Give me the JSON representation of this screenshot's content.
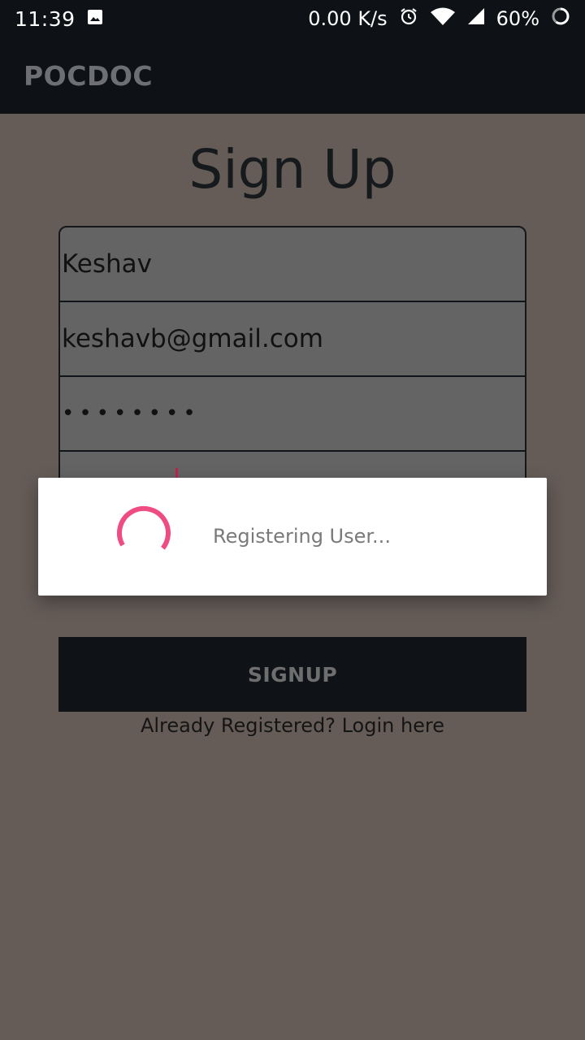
{
  "status_bar": {
    "time": "11:39",
    "network_speed": "0.00 K/s",
    "battery_percent": "60%",
    "icons": [
      "gallery-icon",
      "alarm-icon",
      "wifi-icon",
      "cellular-signal-icon",
      "battery-icon"
    ]
  },
  "app_bar": {
    "title": "POCDOC"
  },
  "page": {
    "title": "Sign Up"
  },
  "form": {
    "name_value": "Keshav",
    "email_value": "keshavb@gmail.com",
    "password_value": "••••••••"
  },
  "actions": {
    "signup_label": "SIGNUP",
    "login_link": "Already Registered? Login here"
  },
  "dialog": {
    "message": "Registering User...",
    "spinner_color": "#ee4c82"
  }
}
